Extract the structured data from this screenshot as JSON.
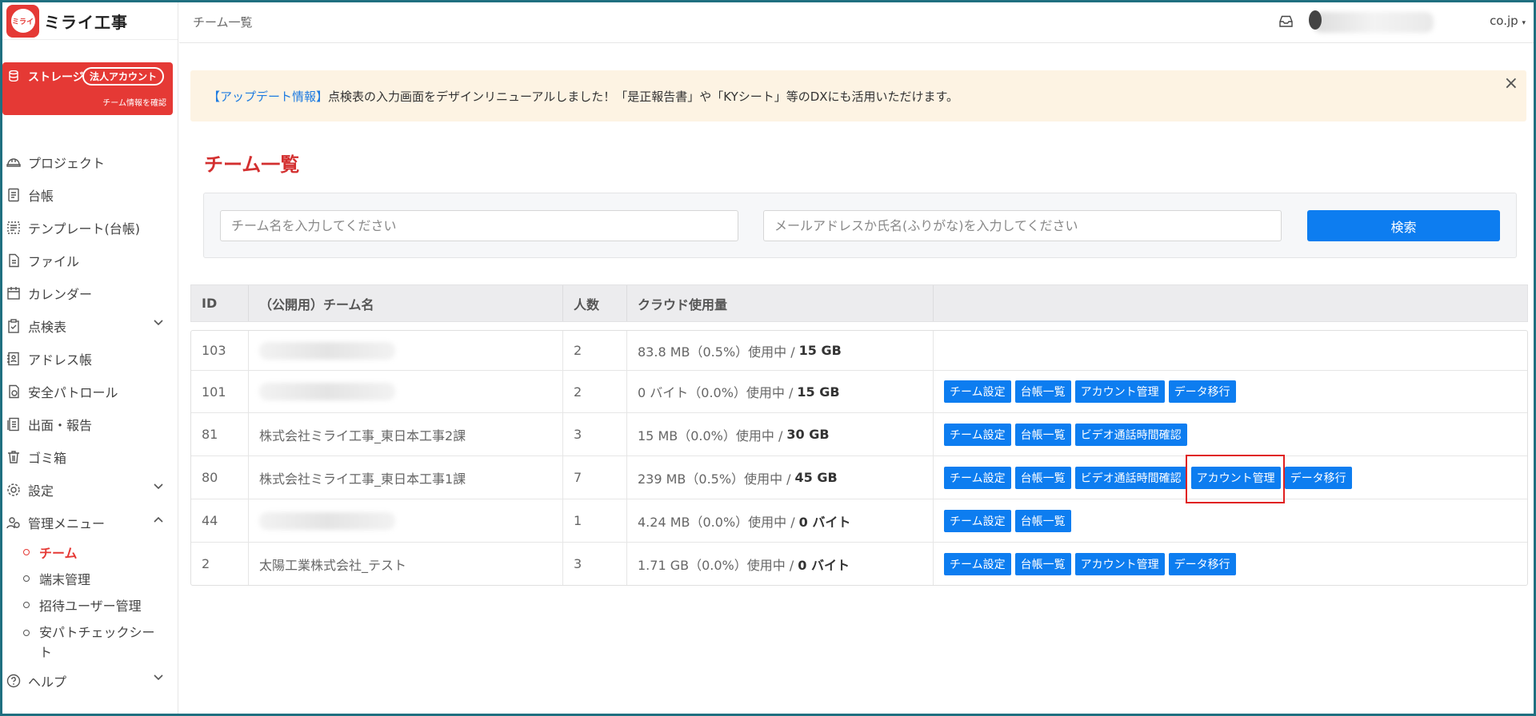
{
  "app": {
    "logo_mark": "ミライ",
    "logo_text": "ミライ工事"
  },
  "storage": {
    "label": "ストレージ",
    "badge": "法人アカウント",
    "sub": "チーム情報を確認"
  },
  "sidebar": {
    "items": [
      {
        "label": "プロジェクト",
        "icon": "helmet-icon"
      },
      {
        "label": "台帳",
        "icon": "ledger-icon"
      },
      {
        "label": "テンプレート(台帳)",
        "icon": "template-icon"
      },
      {
        "label": "ファイル",
        "icon": "file-icon"
      },
      {
        "label": "カレンダー",
        "icon": "calendar-icon"
      },
      {
        "label": "点検表",
        "icon": "clipboard-icon"
      },
      {
        "label": "アドレス帳",
        "icon": "address-book-icon"
      },
      {
        "label": "安全パトロール",
        "icon": "patrol-icon"
      },
      {
        "label": "出面・報告",
        "icon": "report-icon"
      },
      {
        "label": "ゴミ箱",
        "icon": "trash-icon"
      },
      {
        "label": "設定",
        "icon": "gear-icon"
      },
      {
        "label": "管理メニュー",
        "icon": "admin-icon"
      }
    ],
    "sub_items": [
      "チーム",
      "端末管理",
      "招待ユーザー管理",
      "安パトチェックシート"
    ],
    "help": "ヘルプ"
  },
  "header": {
    "breadcrumb": "チーム一覧",
    "user_suffix": "co.jp"
  },
  "alert": {
    "tag": "【アップデート情報】",
    "message": "点検表の入力画面をデザインリニューアルしました！「是正報告書」や「KYシート」等のDXにも活用いただけます。",
    "close": "×"
  },
  "page_title": "チーム一覧",
  "search": {
    "team_placeholder": "チーム名を入力してください",
    "member_placeholder": "メールアドレスか氏名(ふりがな)を入力してください",
    "button": "検索"
  },
  "table": {
    "headers": [
      "ID",
      "（公開用）チーム名",
      "人数",
      "クラウド使用量",
      ""
    ],
    "usage_suffix": "使用中 /",
    "rows": [
      {
        "id": "103",
        "name": "",
        "count": "2",
        "usage": "83.8 MB（0.5%）",
        "quota": "15 GB",
        "actions": []
      },
      {
        "id": "101",
        "name": "",
        "count": "2",
        "usage": "0 バイト（0.0%）",
        "quota": "15 GB",
        "actions": [
          "チーム設定",
          "台帳一覧",
          "アカウント管理",
          "データ移行"
        ]
      },
      {
        "id": "81",
        "name": "株式会社ミライ工事_東日本工事2課",
        "count": "3",
        "usage": "15 MB（0.0%）",
        "quota": "30 GB",
        "actions": [
          "チーム設定",
          "台帳一覧",
          "ビデオ通話時間確認"
        ]
      },
      {
        "id": "80",
        "name": "株式会社ミライ工事_東日本工事1課",
        "count": "7",
        "usage": "239 MB（0.5%）",
        "quota": "45 GB",
        "actions": [
          "チーム設定",
          "台帳一覧",
          "ビデオ通話時間確認",
          "アカウント管理",
          "データ移行"
        ]
      },
      {
        "id": "44",
        "name": "",
        "count": "1",
        "usage": "4.24 MB（0.0%）",
        "quota": "0 バイト",
        "actions": [
          "チーム設定",
          "台帳一覧"
        ]
      },
      {
        "id": "2",
        "name": "太陽工業株式会社_テスト",
        "count": "3",
        "usage": "1.71 GB（0.0%）",
        "quota": "0 バイト",
        "actions": [
          "チーム設定",
          "台帳一覧",
          "アカウント管理",
          "データ移行"
        ]
      }
    ]
  },
  "colors": {
    "brand_red": "#e53935",
    "primary_blue": "#0d7df0",
    "highlight": "#e02020"
  }
}
